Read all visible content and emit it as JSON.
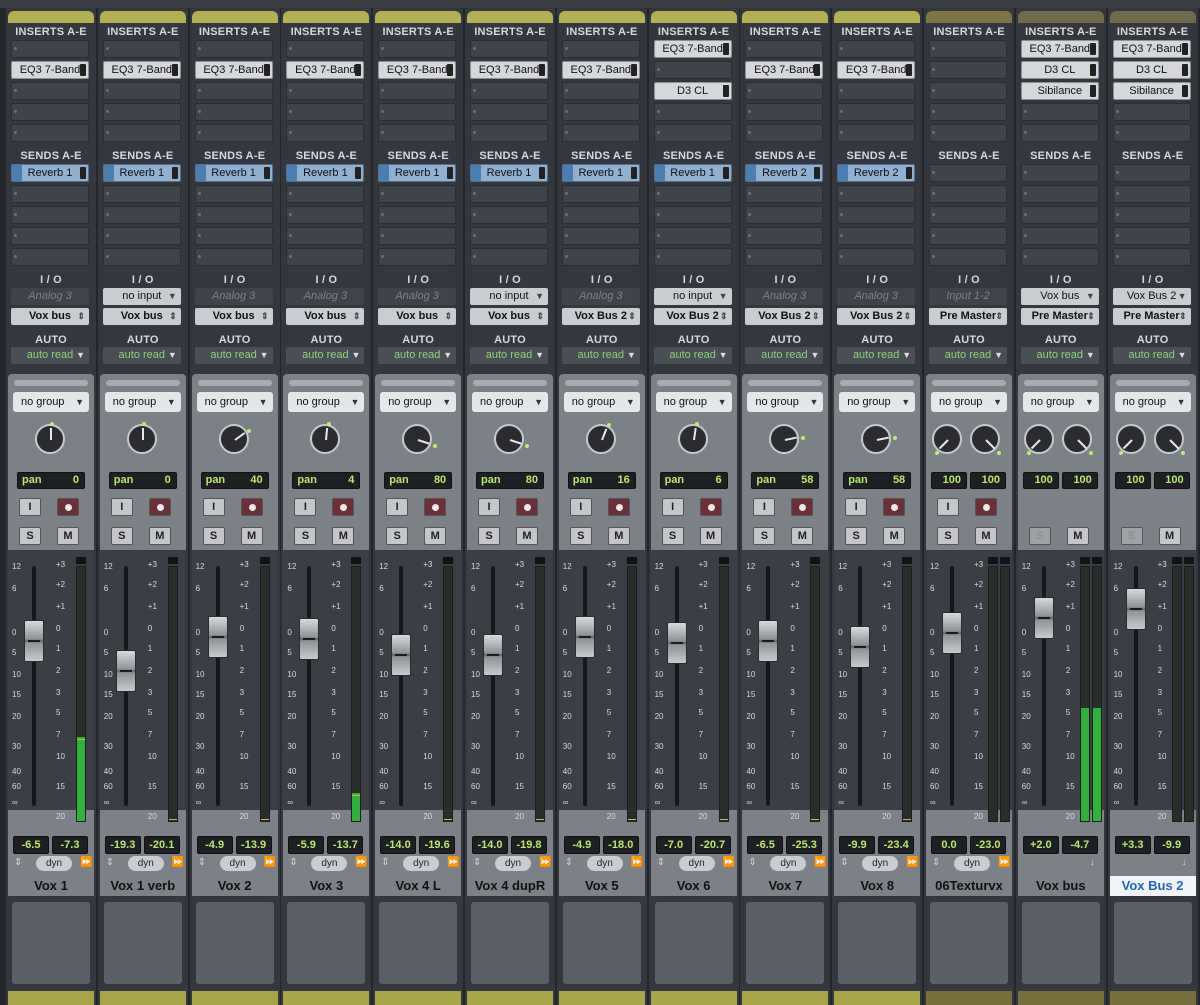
{
  "sections": {
    "inserts": "INSERTS A-E",
    "sends": "SENDS A-E",
    "io": "I / O",
    "auto": "AUTO"
  },
  "strips": [
    {
      "name": "Vox 1",
      "inserts": [
        "",
        "EQ3 7-Band",
        "",
        "",
        ""
      ],
      "send": "Reverb 1",
      "input": "Analog 3",
      "input_live": false,
      "output": "Vox bus",
      "auto": "auto read",
      "group": "no group",
      "pan_label": "pan",
      "pan": "0",
      "stereo": false,
      "left_val": "-6.5",
      "right_val": "-7.3",
      "fader_db": -2.0,
      "meter_db": -7.3,
      "solo_state": "S",
      "mute": "M",
      "input_btn": "I",
      "footer": "dyn"
    },
    {
      "name": "Vox 1 verb",
      "inserts": [
        "",
        "EQ3 7-Band",
        "",
        "",
        ""
      ],
      "send": "Reverb 1",
      "input": "no input",
      "input_live": true,
      "output": "Vox bus",
      "auto": "auto read",
      "group": "no group",
      "pan_label": "pan",
      "pan": "0",
      "stereo": false,
      "left_val": "-19.3",
      "right_val": "-20.1",
      "fader_db": -9.0,
      "meter_db": -20.0,
      "solo_state": "S",
      "mute": "M",
      "input_btn": "I",
      "footer": "dyn"
    },
    {
      "name": "Vox 2",
      "inserts": [
        "",
        "EQ3 7-Band",
        "",
        "",
        ""
      ],
      "send": "Reverb 1",
      "input": "Analog 3",
      "input_live": false,
      "output": "Vox bus",
      "auto": "auto read",
      "group": "no group",
      "pan_label": "pan",
      "pan": "40",
      "stereo": false,
      "left_val": "-4.9",
      "right_val": "-13.9",
      "fader_db": -1.0,
      "meter_db": -40,
      "solo_state": "S",
      "mute": "M",
      "input_btn": "I",
      "footer": "dyn"
    },
    {
      "name": "Vox 3",
      "inserts": [
        "",
        "EQ3 7-Band",
        "",
        "",
        ""
      ],
      "send": "Reverb 1",
      "input": "Analog 3",
      "input_live": false,
      "output": "Vox bus",
      "auto": "auto read",
      "group": "no group",
      "pan_label": "pan",
      "pan": "4",
      "stereo": false,
      "left_val": "-5.9",
      "right_val": "-13.7",
      "fader_db": -1.5,
      "meter_db": -16,
      "solo_state": "S",
      "mute": "M",
      "input_btn": "I",
      "footer": "dyn"
    },
    {
      "name": "Vox 4 L",
      "inserts": [
        "",
        "EQ3 7-Band",
        "",
        "",
        ""
      ],
      "send": "Reverb 1",
      "input": "Analog 3",
      "input_live": false,
      "output": "Vox bus",
      "auto": "auto read",
      "group": "no group",
      "pan_label": "pan",
      "pan": "80",
      "stereo": false,
      "left_val": "-14.0",
      "right_val": "-19.6",
      "fader_db": -5.5,
      "meter_db": -40,
      "solo_state": "S",
      "mute": "M",
      "input_btn": "I",
      "footer": "dyn"
    },
    {
      "name": "Vox 4 dupR",
      "inserts": [
        "",
        "EQ3 7-Band",
        "",
        "",
        ""
      ],
      "send": "Reverb 1",
      "input": "no input",
      "input_live": true,
      "output": "Vox bus",
      "auto": "auto read",
      "group": "no group",
      "pan_label": "pan",
      "pan": "80",
      "stereo": false,
      "left_val": "-14.0",
      "right_val": "-19.8",
      "fader_db": -5.5,
      "meter_db": -40,
      "solo_state": "S",
      "mute": "M",
      "input_btn": "I",
      "footer": "dyn"
    },
    {
      "name": "Vox 5",
      "inserts": [
        "",
        "EQ3 7-Band",
        "",
        "",
        ""
      ],
      "send": "Reverb 1",
      "input": "Analog 3",
      "input_live": false,
      "output": "Vox Bus 2",
      "auto": "auto read",
      "group": "no group",
      "pan_label": "pan",
      "pan": "16",
      "stereo": false,
      "left_val": "-4.9",
      "right_val": "-18.0",
      "fader_db": -1.0,
      "meter_db": -40,
      "solo_state": "S",
      "mute": "M",
      "input_btn": "I",
      "footer": "dyn"
    },
    {
      "name": "Vox 6",
      "inserts": [
        "EQ3 7-Band",
        "",
        "D3 CL",
        "",
        ""
      ],
      "send": "Reverb 1",
      "input": "no input",
      "input_live": true,
      "output": "Vox Bus 2",
      "auto": "auto read",
      "group": "no group",
      "pan_label": "pan",
      "pan": "6",
      "stereo": false,
      "left_val": "-7.0",
      "right_val": "-20.7",
      "fader_db": -2.5,
      "meter_db": -40,
      "solo_state": "S",
      "mute": "M",
      "input_btn": "I",
      "footer": "dyn"
    },
    {
      "name": "Vox  7",
      "inserts": [
        "",
        "EQ3 7-Band",
        "",
        "",
        ""
      ],
      "send": "Reverb 2",
      "input": "Analog 3",
      "input_live": false,
      "output": "Vox Bus 2",
      "auto": "auto read",
      "group": "no group",
      "pan_label": "pan",
      "pan": "58",
      "stereo": false,
      "left_val": "-6.5",
      "right_val": "-25.3",
      "fader_db": -2.0,
      "meter_db": -40,
      "solo_state": "S",
      "mute": "M",
      "input_btn": "I",
      "footer": "dyn"
    },
    {
      "name": "Vox  8",
      "inserts": [
        "",
        "EQ3 7-Band",
        "",
        "",
        ""
      ],
      "send": "Reverb 2",
      "input": "Analog 3",
      "input_live": false,
      "output": "Vox Bus 2",
      "auto": "auto read",
      "group": "no group",
      "pan_label": "pan",
      "pan": "58",
      "stereo": false,
      "left_val": "-9.9",
      "right_val": "-23.4",
      "fader_db": -3.5,
      "meter_db": -40,
      "solo_state": "S",
      "mute": "M",
      "input_btn": "I",
      "footer": "dyn"
    },
    {
      "name": "06Texturvx",
      "inserts": [
        "",
        "",
        "",
        "",
        ""
      ],
      "send": "",
      "input": "Input 1-2",
      "input_live": false,
      "output": "Pre Master",
      "auto": "auto read",
      "group": "no group",
      "pan_label": "",
      "pan": "",
      "stereo": true,
      "pan_l": "100",
      "pan_r": "100",
      "left_val": "0.0",
      "right_val": "-23.0",
      "fader_db": 0.0,
      "meter_db": -40,
      "solo_state": "S",
      "mute": "M",
      "input_btn": "I",
      "footer": "dyn"
    },
    {
      "name": "Vox bus",
      "inserts": [
        "EQ3 7-Band",
        "D3 CL",
        "Sibilance",
        "",
        ""
      ],
      "send": "",
      "input": "Vox bus",
      "input_live": true,
      "output": "Pre Master",
      "auto": "auto read",
      "group": "no group",
      "pan_label": "",
      "pan": "",
      "stereo": true,
      "pan_l": "100",
      "pan_r": "100",
      "left_val": "+2.0",
      "right_val": "-4.7",
      "fader_db": 2.0,
      "meter_db": -4.5,
      "solo_state": "S",
      "mute": "M",
      "input_btn": "",
      "footer": ""
    },
    {
      "name": "Vox Bus 2",
      "inserts": [
        "EQ3 7-Band",
        "D3 CL",
        "Sibilance",
        "",
        ""
      ],
      "send": "",
      "input": "Vox Bus 2",
      "input_live": true,
      "output": "Pre Master",
      "auto": "auto read",
      "group": "no group",
      "pan_label": "",
      "pan": "",
      "stereo": true,
      "pan_l": "100",
      "pan_r": "100",
      "left_val": "+3.3",
      "right_val": "-9.9",
      "fader_db": 3.3,
      "meter_db": -40,
      "solo_state": "S",
      "mute": "M",
      "input_btn": "",
      "footer": "",
      "selected": true
    }
  ],
  "scale_fader": [
    "12",
    "6",
    "0",
    "5",
    "10",
    "15",
    "20",
    "30",
    "40",
    "60",
    "∞"
  ],
  "scale_meter": [
    "+3",
    "+2",
    "+1",
    "0",
    "1",
    "2",
    "3",
    "5",
    "7",
    "10",
    "15",
    "20"
  ],
  "colors": {
    "meter_green": "#2fb23a",
    "display_green": "#b8e86d",
    "selected_name": "#1f63c9",
    "strip_cap": "#b3b14f"
  }
}
